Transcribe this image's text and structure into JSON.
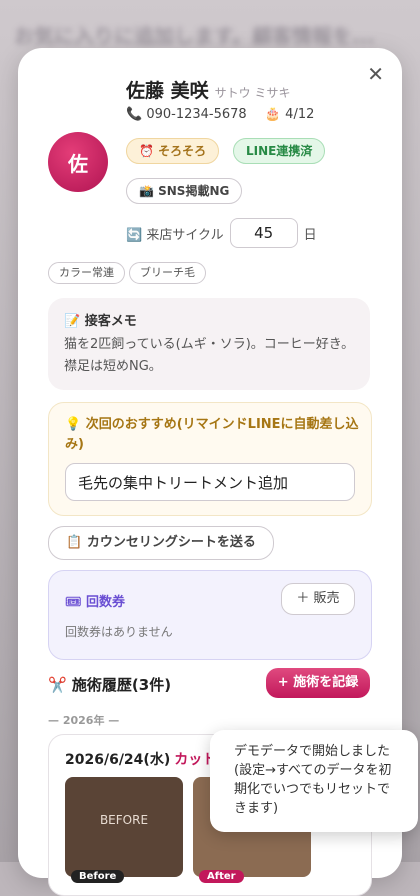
{
  "background": {
    "blurred_text": "お気に入りに追加します。顧客情報を..."
  },
  "customer": {
    "initial": "佐",
    "name": "佐藤 美咲",
    "kana": "サトウ ミサキ",
    "phone": "090-1234-5678",
    "birthday": "4/12",
    "phone_icon": "phone-icon",
    "birthday_icon": "cake-icon"
  },
  "badges": {
    "soon": "⏰ そろそろ",
    "line": "LINE連携済",
    "sns": "📸 SNS掲載NG"
  },
  "cycle": {
    "label": "🔄 来店サイクル",
    "value": "45",
    "unit": "日"
  },
  "tags": [
    "カラー常連",
    "ブリーチ毛"
  ],
  "memo": {
    "title": "📝 接客メモ",
    "body": "猫を2匹飼っている(ムギ・ソラ)。コーヒー好き。襟足は短めNG。"
  },
  "recommend": {
    "title": "💡 次回のおすすめ(リマインドLINEに自動差し込み)",
    "value": "毛先の集中トリートメント追加"
  },
  "counsel_button": "📋 カウンセリングシートを送る",
  "ticket": {
    "title": "🎟 回数券",
    "sell_button": "＋ 販売",
    "empty": "回数券はありません"
  },
  "history": {
    "title": "✂️ 施術履歴(3件)",
    "record_button": "+ 施術を記録",
    "year": "— 2026年 —",
    "entry": {
      "date": "2026/6/24(水)",
      "menu": "カット+カラー",
      "before_caption": "BEFORE",
      "before_label": "Before",
      "after_label": "After"
    }
  },
  "toast": "デモデータで開始しました(設定→すべてのデータを初期化でいつでもリセットできます)",
  "colors": {
    "accent": "#c2185b",
    "soon_badge": "#fdf1d8",
    "line_badge": "#e4f7e8",
    "ticket": "#6a4fd3",
    "recommend": "#a67614"
  }
}
